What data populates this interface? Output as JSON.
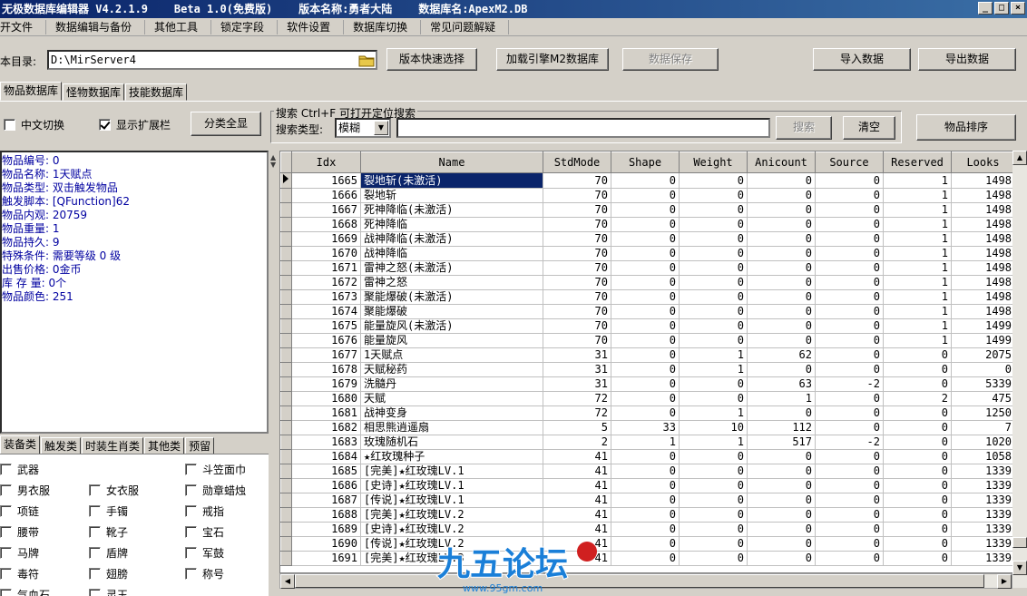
{
  "window": {
    "title": "无极数据库编辑器 V4.2.1.9    Beta 1.0(免费版)    版本名称:勇者大陆    数据库名:ApexM2.DB",
    "min": "_",
    "max": "□",
    "close": "×"
  },
  "menu": [
    "开文件",
    "数据编辑与备份",
    "其他工具",
    "锁定字段",
    "软件设置",
    "数据库切换",
    "常见问题解疑"
  ],
  "toolbar": {
    "path_label": "本目录:",
    "path_value": "D:\\MirServer4",
    "quick_select": "版本快速选择",
    "load_db": "加载引擎M2数据库",
    "save_db": "数据保存",
    "import": "导入数据",
    "export": "导出数据"
  },
  "db_tabs": [
    "物品数据库",
    "怪物数据库",
    "技能数据库"
  ],
  "options": {
    "chinese_switch": "中文切换",
    "show_ext": "显示扩展栏",
    "category_all": "分类全显"
  },
  "search": {
    "group_title": "搜索  Ctrl+F 可打开定位搜索",
    "type_label": "搜索类型:",
    "type_value": "模糊",
    "query": "",
    "search_btn": "搜索",
    "clear_btn": "清空",
    "sort_btn": "物品排序"
  },
  "info": [
    "物品编号: 0",
    "物品名称: 1天赋点",
    "物品类型: 双击触发物品",
    "触发脚本: [QFunction]62",
    "物品内观: 20759",
    "物品重量: 1",
    "物品持久: 9",
    "特殊条件: 需要等级 0 级",
    "出售价格: 0金币",
    "库 存 量: 0个",
    "物品颜色: 251"
  ],
  "cat_tabs": [
    "装备类",
    "触发类",
    "时装生肖类",
    "其他类",
    "预留"
  ],
  "categories": [
    "武器",
    "斗笠面巾",
    "男衣服",
    "女衣服",
    "勋章蜡烛",
    "项链",
    "手镯",
    "戒指",
    "腰带",
    "靴子",
    "宝石",
    "马牌",
    "盾牌",
    "军鼓",
    "毒符",
    "翅膀",
    "称号",
    "气血石",
    "灵玉"
  ],
  "columns": [
    "Idx",
    "Name",
    "StdMode",
    "Shape",
    "Weight",
    "Anicount",
    "Source",
    "Reserved",
    "Looks"
  ],
  "rows": [
    [
      "1665",
      "裂地斩(未激活)",
      "70",
      "0",
      "0",
      "0",
      "0",
      "1",
      "1498"
    ],
    [
      "1666",
      "裂地斩",
      "70",
      "0",
      "0",
      "0",
      "0",
      "1",
      "1498"
    ],
    [
      "1667",
      "死神降临(未激活)",
      "70",
      "0",
      "0",
      "0",
      "0",
      "1",
      "1498"
    ],
    [
      "1668",
      "死神降临",
      "70",
      "0",
      "0",
      "0",
      "0",
      "1",
      "1498"
    ],
    [
      "1669",
      "战神降临(未激活)",
      "70",
      "0",
      "0",
      "0",
      "0",
      "1",
      "1498"
    ],
    [
      "1670",
      "战神降临",
      "70",
      "0",
      "0",
      "0",
      "0",
      "1",
      "1498"
    ],
    [
      "1671",
      "雷神之怒(未激活)",
      "70",
      "0",
      "0",
      "0",
      "0",
      "1",
      "1498"
    ],
    [
      "1672",
      "雷神之怒",
      "70",
      "0",
      "0",
      "0",
      "0",
      "1",
      "1498"
    ],
    [
      "1673",
      "聚能爆破(未激活)",
      "70",
      "0",
      "0",
      "0",
      "0",
      "1",
      "1498"
    ],
    [
      "1674",
      "聚能爆破",
      "70",
      "0",
      "0",
      "0",
      "0",
      "1",
      "1498"
    ],
    [
      "1675",
      "能量旋风(未激活)",
      "70",
      "0",
      "0",
      "0",
      "0",
      "1",
      "1499"
    ],
    [
      "1676",
      "能量旋风",
      "70",
      "0",
      "0",
      "0",
      "0",
      "1",
      "1499"
    ],
    [
      "1677",
      "1天赋点",
      "31",
      "0",
      "1",
      "62",
      "0",
      "0",
      "2075"
    ],
    [
      "1678",
      "天赋秘药",
      "31",
      "0",
      "1",
      "0",
      "0",
      "0",
      "0"
    ],
    [
      "1679",
      "洗髓丹",
      "31",
      "0",
      "0",
      "63",
      "-2",
      "0",
      "5339"
    ],
    [
      "1680",
      "天赋",
      "72",
      "0",
      "0",
      "1",
      "0",
      "2",
      "475"
    ],
    [
      "1681",
      "战神变身",
      "72",
      "0",
      "1",
      "0",
      "0",
      "0",
      "1250"
    ],
    [
      "1682",
      "相思熊逍遥扇",
      "5",
      "33",
      "10",
      "112",
      "0",
      "0",
      "7"
    ],
    [
      "1683",
      "玫瑰随机石",
      "2",
      "1",
      "1",
      "517",
      "-2",
      "0",
      "1020"
    ],
    [
      "1684",
      "★红玫瑰种子",
      "41",
      "0",
      "0",
      "0",
      "0",
      "0",
      "1058"
    ],
    [
      "1685",
      "[完美]★红玫瑰LV.1",
      "41",
      "0",
      "0",
      "0",
      "0",
      "0",
      "1339"
    ],
    [
      "1686",
      "[史诗]★红玫瑰LV.1",
      "41",
      "0",
      "0",
      "0",
      "0",
      "0",
      "1339"
    ],
    [
      "1687",
      "[传说]★红玫瑰LV.1",
      "41",
      "0",
      "0",
      "0",
      "0",
      "0",
      "1339"
    ],
    [
      "1688",
      "[完美]★红玫瑰LV.2",
      "41",
      "0",
      "0",
      "0",
      "0",
      "0",
      "1339"
    ],
    [
      "1689",
      "[史诗]★红玫瑰LV.2",
      "41",
      "0",
      "0",
      "0",
      "0",
      "0",
      "1339"
    ],
    [
      "1690",
      "[传说]★红玫瑰LV.2",
      "41",
      "0",
      "0",
      "0",
      "0",
      "0",
      "1339"
    ],
    [
      "1691",
      "[完美]★红玫瑰LV.3",
      "41",
      "0",
      "0",
      "0",
      "0",
      "0",
      "1339"
    ]
  ],
  "watermark": {
    "brand": "九五论坛",
    "url": "www.95gm.com"
  }
}
